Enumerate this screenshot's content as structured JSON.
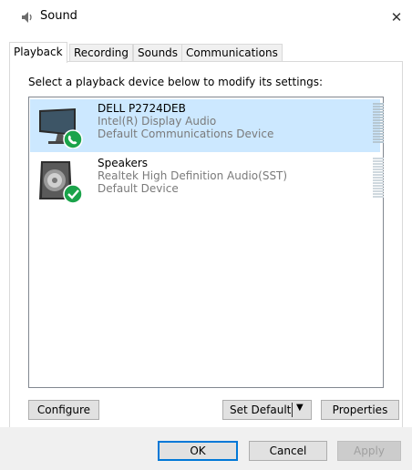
{
  "window": {
    "title": "Sound",
    "icon": "speaker-icon",
    "close_glyph": "✕"
  },
  "tabs": [
    {
      "label": "Playback",
      "active": true
    },
    {
      "label": "Recording",
      "active": false
    },
    {
      "label": "Sounds",
      "active": false
    },
    {
      "label": "Communications",
      "active": false
    }
  ],
  "playback": {
    "instruction": "Select a playback device below to modify its settings:",
    "devices": [
      {
        "name": "DELL P2724DEB",
        "driver": "Intel(R) Display Audio",
        "status": "Default Communications Device",
        "icon": "monitor-icon",
        "badge": "phone-check-badge",
        "selected": true
      },
      {
        "name": "Speakers",
        "driver": "Realtek High Definition Audio(SST)",
        "status": "Default Device",
        "icon": "speaker-device-icon",
        "badge": "check-badge",
        "selected": false
      }
    ],
    "buttons": {
      "configure": "Configure",
      "set_default": "Set Default",
      "set_default_arrow": "▼",
      "properties": "Properties"
    }
  },
  "footer": {
    "ok": "OK",
    "cancel": "Cancel",
    "apply": "Apply"
  },
  "colors": {
    "selection": "#cce8ff",
    "badge_green": "#1aa34a",
    "accent": "#0078d7"
  }
}
